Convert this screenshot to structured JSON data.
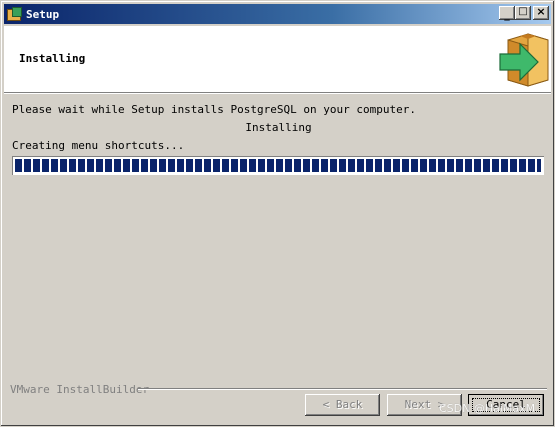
{
  "window": {
    "title": "Setup"
  },
  "header": {
    "title": "Installing"
  },
  "body": {
    "message": "Please wait while Setup installs PostgreSQL on your computer.",
    "status": "Installing",
    "action": "Creating menu shortcuts...",
    "progress_fraction": 1.0
  },
  "footer": {
    "brand": "VMware InstallBuilder",
    "back_label": "< Back",
    "next_label": "Next >",
    "cancel_label": "Cancel"
  },
  "watermark": "CSDN @HaiMaxM",
  "colors": {
    "titlebar": "#0a246a",
    "progress": "#0a246a",
    "face": "#d4d0c8"
  }
}
